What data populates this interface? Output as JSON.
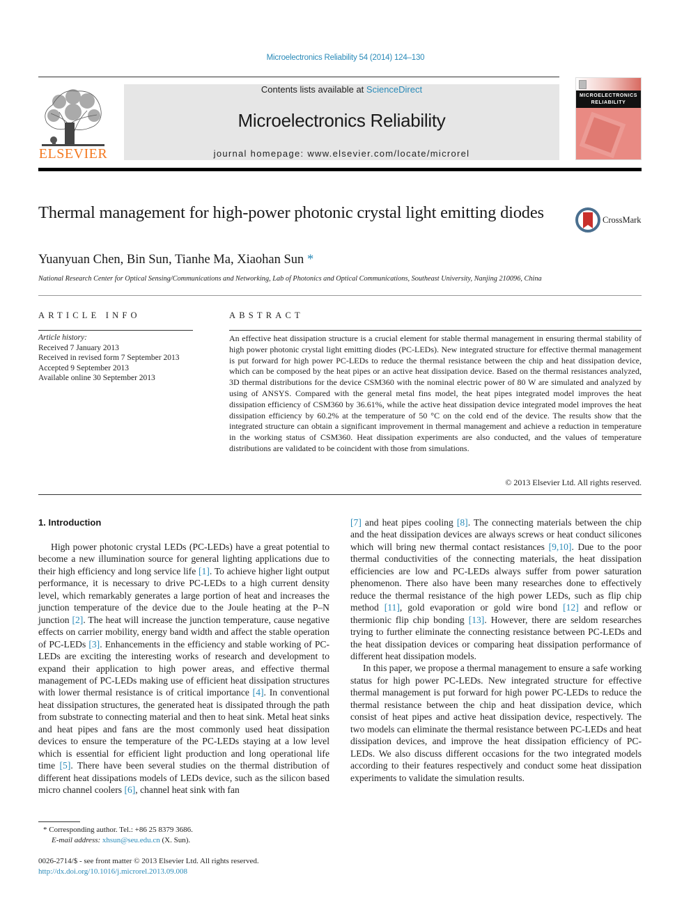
{
  "header": {
    "citation": "Microelectronics Reliability 54 (2014) 124–130",
    "publisher_logo_text": "ELSEVIER",
    "contents_prefix": "Contents lists available at ",
    "contents_link": "ScienceDirect",
    "journal_name": "Microelectronics Reliability",
    "homepage": "journal homepage: www.elsevier.com/locate/microrel",
    "cover_title_line1": "MICROELECTRONICS",
    "cover_title_line2": "RELIABILITY"
  },
  "article": {
    "title": "Thermal management for high-power photonic crystal light emitting diodes",
    "crossmark_label": "CrossMark",
    "authors": "Yuanyuan Chen, Bin Sun, Tianhe Ma, Xiaohan Sun",
    "corresponding_marker": "*",
    "affiliation": "National Research Center for Optical Sensing/Communications and Networking, Lab of Photonics and Optical Communications, Southeast University, Nanjing 210096, China"
  },
  "article_info": {
    "heading": "ARTICLE INFO",
    "history_label": "Article history:",
    "history": [
      "Received 7 January 2013",
      "Received in revised form 7 September 2013",
      "Accepted 9 September 2013",
      "Available online 30 September 2013"
    ]
  },
  "abstract": {
    "heading": "ABSTRACT",
    "text": "An effective heat dissipation structure is a crucial element for stable thermal management in ensuring thermal stability of high power photonic crystal light emitting diodes (PC-LEDs). New integrated structure for effective thermal management is put forward for high power PC-LEDs to reduce the thermal resistance between the chip and heat dissipation device, which can be composed by the heat pipes or an active heat dissipation device. Based on the thermal resistances analyzed, 3D thermal distributions for the device CSM360 with the nominal electric power of 80 W are simulated and analyzed by using of ANSYS. Compared with the general metal fins model, the heat pipes integrated model improves the heat dissipation efficiency of CSM360 by 36.61%, while the active heat dissipation device integrated model improves the heat dissipation efficiency by 60.2% at the temperature of 50 °C on the cold end of the device. The results show that the integrated structure can obtain a significant improvement in thermal management and achieve a reduction in temperature in the working status of CSM360. Heat dissipation experiments are also conducted, and the values of temperature distributions are validated to be coincident with those from simulations.",
    "copyright": "© 2013 Elsevier Ltd. All rights reserved."
  },
  "intro": {
    "heading": "1. Introduction",
    "p1": [
      {
        "t": "High power photonic crystal LEDs (PC-LEDs) have a great potential to become a new illumination source for general lighting applications due to their high efficiency and long service life "
      },
      {
        "ref": "[1]"
      },
      {
        "t": ". To achieve higher light output performance, it is necessary to drive PC-LEDs to a high current density level, which remarkably generates a large portion of heat and increases the junction temperature of the device due to the Joule heating at the P–N junction "
      },
      {
        "ref": "[2]"
      },
      {
        "t": ". The heat will increase the junction temperature, cause negative effects on carrier mobility, energy band width and affect the stable operation of PC-LEDs "
      },
      {
        "ref": "[3]"
      },
      {
        "t": ". Enhancements in the efficiency and stable working of PC-LEDs are exciting the interesting works of research and development to expand their application to high power areas, and effective thermal management of PC-LEDs making use of efficient heat dissipation structures with lower thermal resistance is of critical importance "
      },
      {
        "ref": "[4]"
      },
      {
        "t": ". In conventional heat dissipation structures, the generated heat is dissipated through the path from substrate to connecting material and then to heat sink. Metal heat sinks and heat pipes and fans are the most commonly used heat dissipation devices to ensure the temperature of the PC-LEDs staying at a low level which is essential for efficient light production and long operational life time "
      },
      {
        "ref": "[5]"
      },
      {
        "t": ". There have been several studies on the thermal distribution of different heat dissipations models of LEDs device, such as the silicon based micro channel coolers "
      },
      {
        "ref": "[6]"
      },
      {
        "t": ", channel heat sink with fan "
      },
      {
        "ref": "[7]"
      },
      {
        "t": " and heat pipes cooling "
      },
      {
        "ref": "[8]"
      },
      {
        "t": ". The connecting materials between the chip and the heat dissipation devices are always screws or heat conduct silicones which will bring new thermal contact resistances "
      },
      {
        "ref": "[9,10]"
      },
      {
        "t": ". Due to the poor thermal conductivities of the connecting materials, the heat dissipation efficiencies are low and PC-LEDs always suffer from power saturation phenomenon. There also have been many researches done to effectively reduce the thermal resistance of the high power LEDs, such as flip chip method "
      },
      {
        "ref": "[11]"
      },
      {
        "t": ", gold evaporation or gold wire bond "
      },
      {
        "ref": "[12]"
      },
      {
        "t": " and reflow or thermionic flip chip bonding "
      },
      {
        "ref": "[13]"
      },
      {
        "t": ". However, there are seldom researches trying to further eliminate the connecting resistance between PC-LEDs and the heat dissipation devices or comparing heat dissipation performance of different heat dissipation models."
      }
    ],
    "p1_split_index": 12,
    "p2": "In this paper, we propose a thermal management to ensure a safe working status for high power PC-LEDs. New integrated structure for effective thermal management is put forward for high power PC-LEDs to reduce the thermal resistance between the chip and heat dissipation device, which consist of heat pipes and active heat dissipation device, respectively. The two models can eliminate the thermal resistance between PC-LEDs and heat dissipation devices, and improve the heat dissipation efficiency of PC-LEDs. We also discuss different occasions for the two integrated models according to their features respectively and conduct some heat dissipation experiments to validate the simulation results."
  },
  "footnote": {
    "marker": "*",
    "corresponding": "Corresponding author. Tel.: +86 25 8379 3686.",
    "email_label": "E-mail address:",
    "email": "xhsun@seu.edu.cn",
    "email_suffix": " (X. Sun).",
    "front_matter": "0026-2714/$ - see front matter © 2013 Elsevier Ltd. All rights reserved.",
    "doi": "http://dx.doi.org/10.1016/j.microrel.2013.09.008"
  }
}
